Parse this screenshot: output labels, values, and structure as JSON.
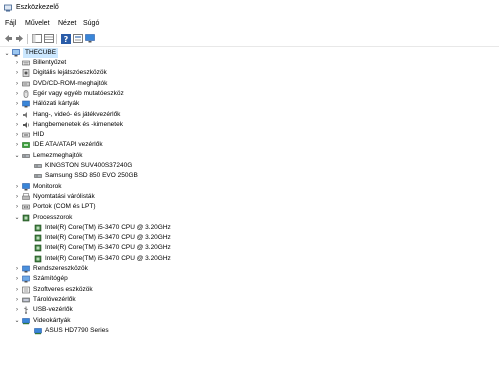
{
  "window": {
    "title": "Eszközkezelő"
  },
  "menu": {
    "items": [
      "Fájl",
      "Művelet",
      "Nézet",
      "Súgó"
    ]
  },
  "toolbar": {
    "buttons": [
      "back-icon",
      "forward-icon",
      "properties-window-icon",
      "view-icon",
      "help-icon",
      "scan-icon",
      "monitor-icon"
    ]
  },
  "tree": {
    "root": {
      "label": "THECUBE",
      "expanded": true
    },
    "items": [
      {
        "label": "Billentyűzet",
        "level": 1,
        "icon": "keyboard-icon",
        "expander": "collapsed"
      },
      {
        "label": "Digitális lejátszóeszközök",
        "level": 1,
        "icon": "media-player-icon",
        "expander": "collapsed"
      },
      {
        "label": "DVD/CD-ROM-meghajtók",
        "level": 1,
        "icon": "dvd-drive-icon",
        "expander": "collapsed"
      },
      {
        "label": "Egér vagy egyéb mutatóeszköz",
        "level": 1,
        "icon": "mouse-icon",
        "expander": "collapsed"
      },
      {
        "label": "Hálózati kártyák",
        "level": 1,
        "icon": "network-adapter-icon",
        "expander": "collapsed"
      },
      {
        "label": "Hang-, videó- és játékvezérlők",
        "level": 1,
        "icon": "sound-icon",
        "expander": "collapsed"
      },
      {
        "label": "Hangbemenetek és -kimenetek",
        "level": 1,
        "icon": "audio-io-icon",
        "expander": "collapsed"
      },
      {
        "label": "HID",
        "level": 1,
        "icon": "hid-icon",
        "expander": "collapsed"
      },
      {
        "label": "IDE ATA/ATAPI vezérlők",
        "level": 1,
        "icon": "ide-controller-icon",
        "expander": "collapsed"
      },
      {
        "label": "Lemezmeghajtók",
        "level": 1,
        "icon": "disk-drive-icon",
        "expander": "expanded"
      },
      {
        "label": "KINGSTON SUV400S37240G",
        "level": 2,
        "icon": "disk-drive-icon",
        "expander": "none"
      },
      {
        "label": "Samsung SSD 850 EVO 250GB",
        "level": 2,
        "icon": "disk-drive-icon",
        "expander": "none"
      },
      {
        "label": "Monitorok",
        "level": 1,
        "icon": "monitor-icon",
        "expander": "collapsed"
      },
      {
        "label": "Nyomtatási várólisták",
        "level": 1,
        "icon": "printer-icon",
        "expander": "collapsed"
      },
      {
        "label": "Portok (COM és LPT)",
        "level": 1,
        "icon": "port-icon",
        "expander": "collapsed"
      },
      {
        "label": "Processzorok",
        "level": 1,
        "icon": "processor-icon",
        "expander": "expanded"
      },
      {
        "label": "Intel(R) Core(TM) i5-3470 CPU @ 3.20GHz",
        "level": 2,
        "icon": "processor-icon",
        "expander": "none"
      },
      {
        "label": "Intel(R) Core(TM) i5-3470 CPU @ 3.20GHz",
        "level": 2,
        "icon": "processor-icon",
        "expander": "none"
      },
      {
        "label": "Intel(R) Core(TM) i5-3470 CPU @ 3.20GHz",
        "level": 2,
        "icon": "processor-icon",
        "expander": "none"
      },
      {
        "label": "Intel(R) Core(TM) i5-3470 CPU @ 3.20GHz",
        "level": 2,
        "icon": "processor-icon",
        "expander": "none"
      },
      {
        "label": "Rendszereszközök",
        "level": 1,
        "icon": "system-devices-icon",
        "expander": "collapsed"
      },
      {
        "label": "Számítógép",
        "level": 1,
        "icon": "computer-icon",
        "expander": "collapsed"
      },
      {
        "label": "Szoftveres eszközök",
        "level": 1,
        "icon": "software-device-icon",
        "expander": "collapsed"
      },
      {
        "label": "Tárolóvezérlők",
        "level": 1,
        "icon": "storage-controller-icon",
        "expander": "collapsed"
      },
      {
        "label": "USB-vezérlők",
        "level": 1,
        "icon": "usb-icon",
        "expander": "collapsed"
      },
      {
        "label": "Videokártyák",
        "level": 1,
        "icon": "display-adapter-icon",
        "expander": "expanded"
      },
      {
        "label": "ASUS HD7790 Series",
        "level": 2,
        "icon": "display-adapter-icon",
        "expander": "none"
      }
    ]
  },
  "colors": {
    "selection": "#cce8ff",
    "help_blue": "#2a5ca8"
  }
}
